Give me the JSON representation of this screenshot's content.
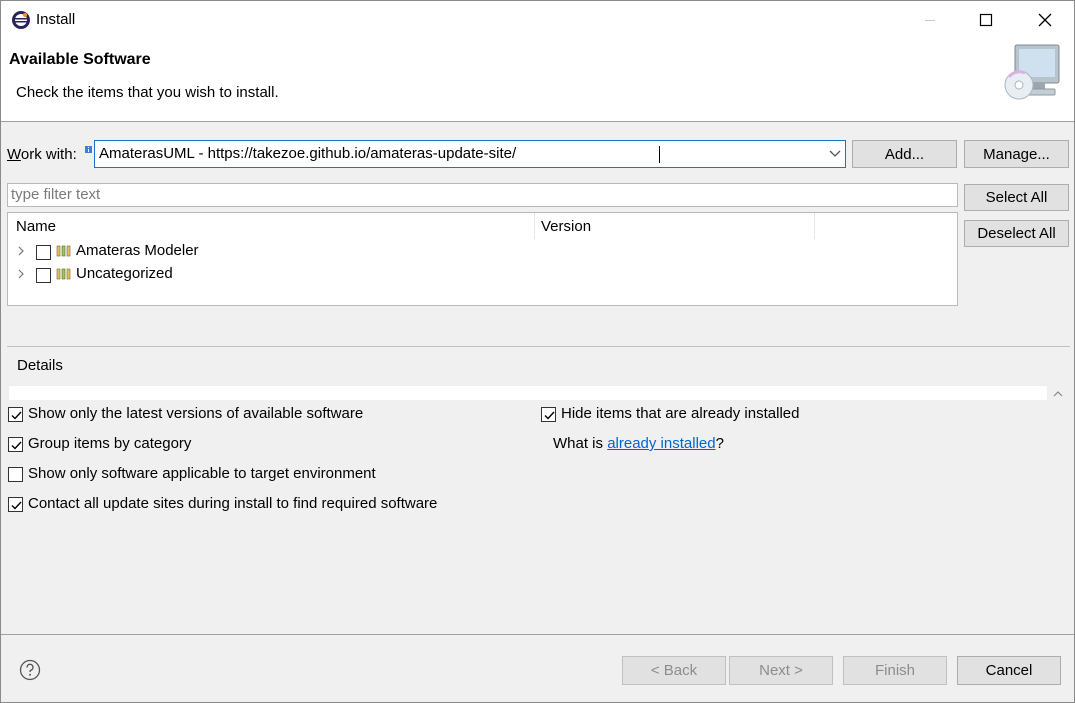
{
  "window": {
    "title": "Install"
  },
  "header": {
    "title": "Available Software",
    "subtitle": "Check the items that you wish to install."
  },
  "work_with": {
    "label_prefix": "W",
    "label_rest": "ork with:",
    "value": "AmaterasUML - https://takezoe.github.io/amateras-update-site/",
    "add_label": "Add...",
    "manage_label": "Manage..."
  },
  "filter": {
    "placeholder": "type filter text"
  },
  "side_buttons": {
    "select_all": "Select All",
    "deselect_all": "Deselect All"
  },
  "table": {
    "columns": [
      "Name",
      "Version"
    ],
    "rows": [
      {
        "name": "Amateras Modeler",
        "version": "",
        "checked": false
      },
      {
        "name": "Uncategorized",
        "version": "",
        "checked": false
      }
    ]
  },
  "details": {
    "label": "Details"
  },
  "options": {
    "latest_only": {
      "label": "Show only the latest versions of available software",
      "checked": true
    },
    "group_by_category": {
      "label": "Group items by category",
      "checked": true
    },
    "target_env": {
      "label": "Show only software applicable to target environment",
      "checked": false
    },
    "contact_sites": {
      "label": "Contact all update sites during install to find required software",
      "checked": true
    },
    "hide_installed": {
      "label": "Hide items that are already installed",
      "checked": true
    },
    "what_is_prefix": "What is ",
    "what_is_link": "already installed",
    "what_is_suffix": "?"
  },
  "footer": {
    "back": "< Back",
    "next": "Next >",
    "finish": "Finish",
    "cancel": "Cancel"
  },
  "colors": {
    "accent": "#1a73c8",
    "link": "#0066cc",
    "panel": "#f0f0f0"
  }
}
